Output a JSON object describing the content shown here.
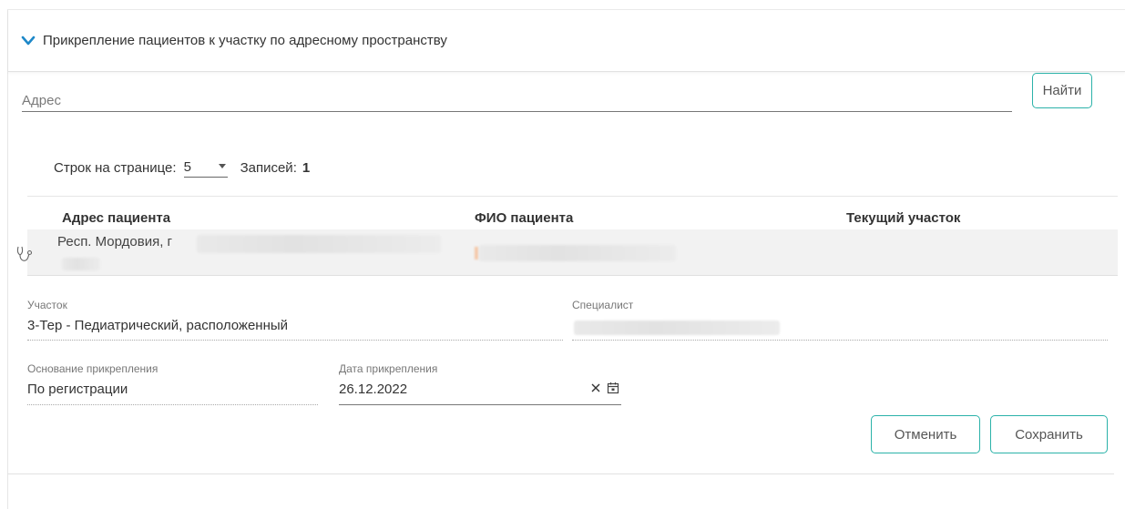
{
  "section": {
    "title": "Прикрепление пациентов к участку по адресному пространству"
  },
  "search": {
    "placeholder": "Адрес",
    "value": "",
    "button_label": "Найти"
  },
  "pager": {
    "rows_label": "Строк на странице:",
    "rows_value": "5",
    "records_label": "Записей:",
    "records_value": "1"
  },
  "table": {
    "headers": [
      "Адрес пациента",
      "ФИО пациента",
      "Текущий участок"
    ],
    "rows": [
      {
        "address": "Респ. Мордовия, г",
        "fio": "",
        "current_area": ""
      }
    ]
  },
  "detail": {
    "area_label": "Участок",
    "area_value": "3-Тер - Педиатрический, расположенный",
    "specialist_label": "Специалист",
    "specialist_value": "",
    "basis_label": "Основание прикрепления",
    "basis_value": "По регистрации",
    "date_label": "Дата прикрепления",
    "date_value": "26.12.2022"
  },
  "actions": {
    "cancel_label": "Отменить",
    "save_label": "Сохранить"
  },
  "colors": {
    "accent": "#2bb2a9",
    "chevron": "#1e88c8"
  },
  "icons": {
    "collapse": "chevron-down-icon",
    "row": "stethoscope-icon",
    "clear": "close-icon",
    "calendar": "calendar-icon",
    "select": "caret-down-icon"
  }
}
